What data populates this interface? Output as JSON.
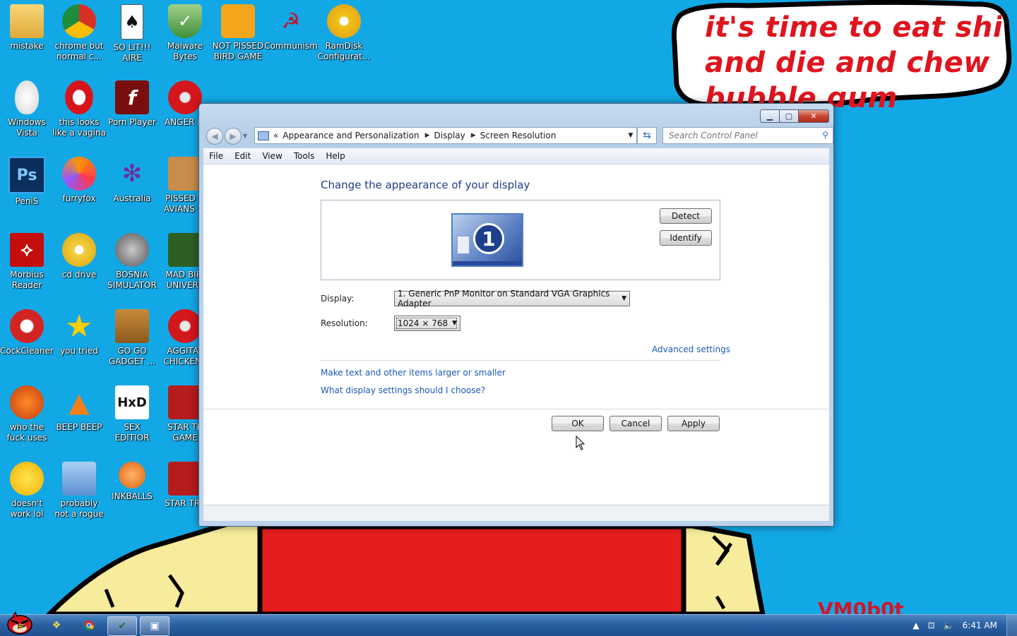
{
  "bubble": {
    "line1": "it's time to eat shit",
    "line2": "and die and chew",
    "line3": "bubble gum"
  },
  "watermark": "VM0b0t",
  "desktop_icons": [
    {
      "label": "mistake",
      "icon": "folder-computer-icon"
    },
    {
      "label": "chrome but normal c...",
      "icon": "chrome-icon"
    },
    {
      "label": "SO LIT!!! AIRE",
      "icon": "solitaire-icon"
    },
    {
      "label": "Malware Bytes",
      "icon": "shield-icon"
    },
    {
      "label": "NOT PISSED BIRD GAME",
      "icon": "pig-icon"
    },
    {
      "label": "Communism",
      "icon": "hammer-sickle-icon"
    },
    {
      "label": "RamDisk Configurat...",
      "icon": "disc-icon"
    },
    {
      "label": "Windows Vista",
      "icon": "egg-icon"
    },
    {
      "label": "this looks like a vagina lol",
      "icon": "opera-icon"
    },
    {
      "label": "Porn Player",
      "icon": "flash-icon"
    },
    {
      "label": "ANGER BI",
      "icon": "angry-bird-icon"
    },
    {
      "label": "PeniS",
      "icon": "photoshop-icon"
    },
    {
      "label": "furryfox",
      "icon": "firefox-icon"
    },
    {
      "label": "Australia",
      "icon": "spider-solitaire-icon"
    },
    {
      "label": "PISSED O AVIANS IN",
      "icon": "angry-birds-seasons-icon"
    },
    {
      "label": "Morbius Reader",
      "icon": "acrobat-icon"
    },
    {
      "label": "cd drive",
      "icon": "cd-icon"
    },
    {
      "label": "BOSNIA SIMULATOR",
      "icon": "minesweeper-icon"
    },
    {
      "label": "MAD BIRI UNIVERS",
      "icon": "angry-birds-space-icon"
    },
    {
      "label": "CockCleaner",
      "icon": "ccleaner-icon"
    },
    {
      "label": "you tried",
      "icon": "star-icon"
    },
    {
      "label": "GO GO GADGET ...",
      "icon": "briefcase-icon"
    },
    {
      "label": "AGGITAT CHICKENS",
      "icon": "angry-bird-icon"
    },
    {
      "label": "who the fuck uses this",
      "icon": "winamp-icon"
    },
    {
      "label": "BEEP BEEP",
      "icon": "vlc-icon"
    },
    {
      "label": "SEX EDITIOR",
      "icon": "hxd-icon"
    },
    {
      "label": "STAR TR GAME",
      "icon": "star-wars-birds-icon"
    },
    {
      "label": "doesn't work lol",
      "icon": "yahoo-messenger-icon"
    },
    {
      "label": "probably not a rogue",
      "icon": "control-panel-icon"
    },
    {
      "label": "INKBALLS",
      "icon": "inkball-icon"
    },
    {
      "label": "STAR TRE",
      "icon": "star-wars-birds-icon"
    }
  ],
  "window": {
    "breadcrumb": [
      "Appearance and Personalization",
      "Display",
      "Screen Resolution"
    ],
    "search_placeholder": "Search Control Panel",
    "menu": [
      "File",
      "Edit",
      "View",
      "Tools",
      "Help"
    ],
    "heading": "Change the appearance of your display",
    "monitor_number": "1",
    "detect_label": "Detect",
    "identify_label": "Identify",
    "display_label": "Display:",
    "display_value": "1. Generic PnP Monitor on Standard VGA Graphics Adapter",
    "resolution_label": "Resolution:",
    "resolution_value": "1024 × 768",
    "advanced_link": "Advanced settings",
    "link_text_size": "Make text and other items larger or smaller",
    "link_which_settings": "What display settings should I choose?",
    "ok_label": "OK",
    "cancel_label": "Cancel",
    "apply_label": "Apply"
  },
  "taskbar": {
    "clock": "6:41 AM",
    "pinned": [
      "start-angry-bird-icon",
      "explorer-icon",
      "chrome-icon",
      "control-panel-icon",
      "display-settings-icon"
    ]
  },
  "colors": {
    "desktop_bg": "#12a8e6",
    "bubble_text": "#e0141e",
    "link": "#1a5ab8",
    "heading": "#1e3f87"
  }
}
